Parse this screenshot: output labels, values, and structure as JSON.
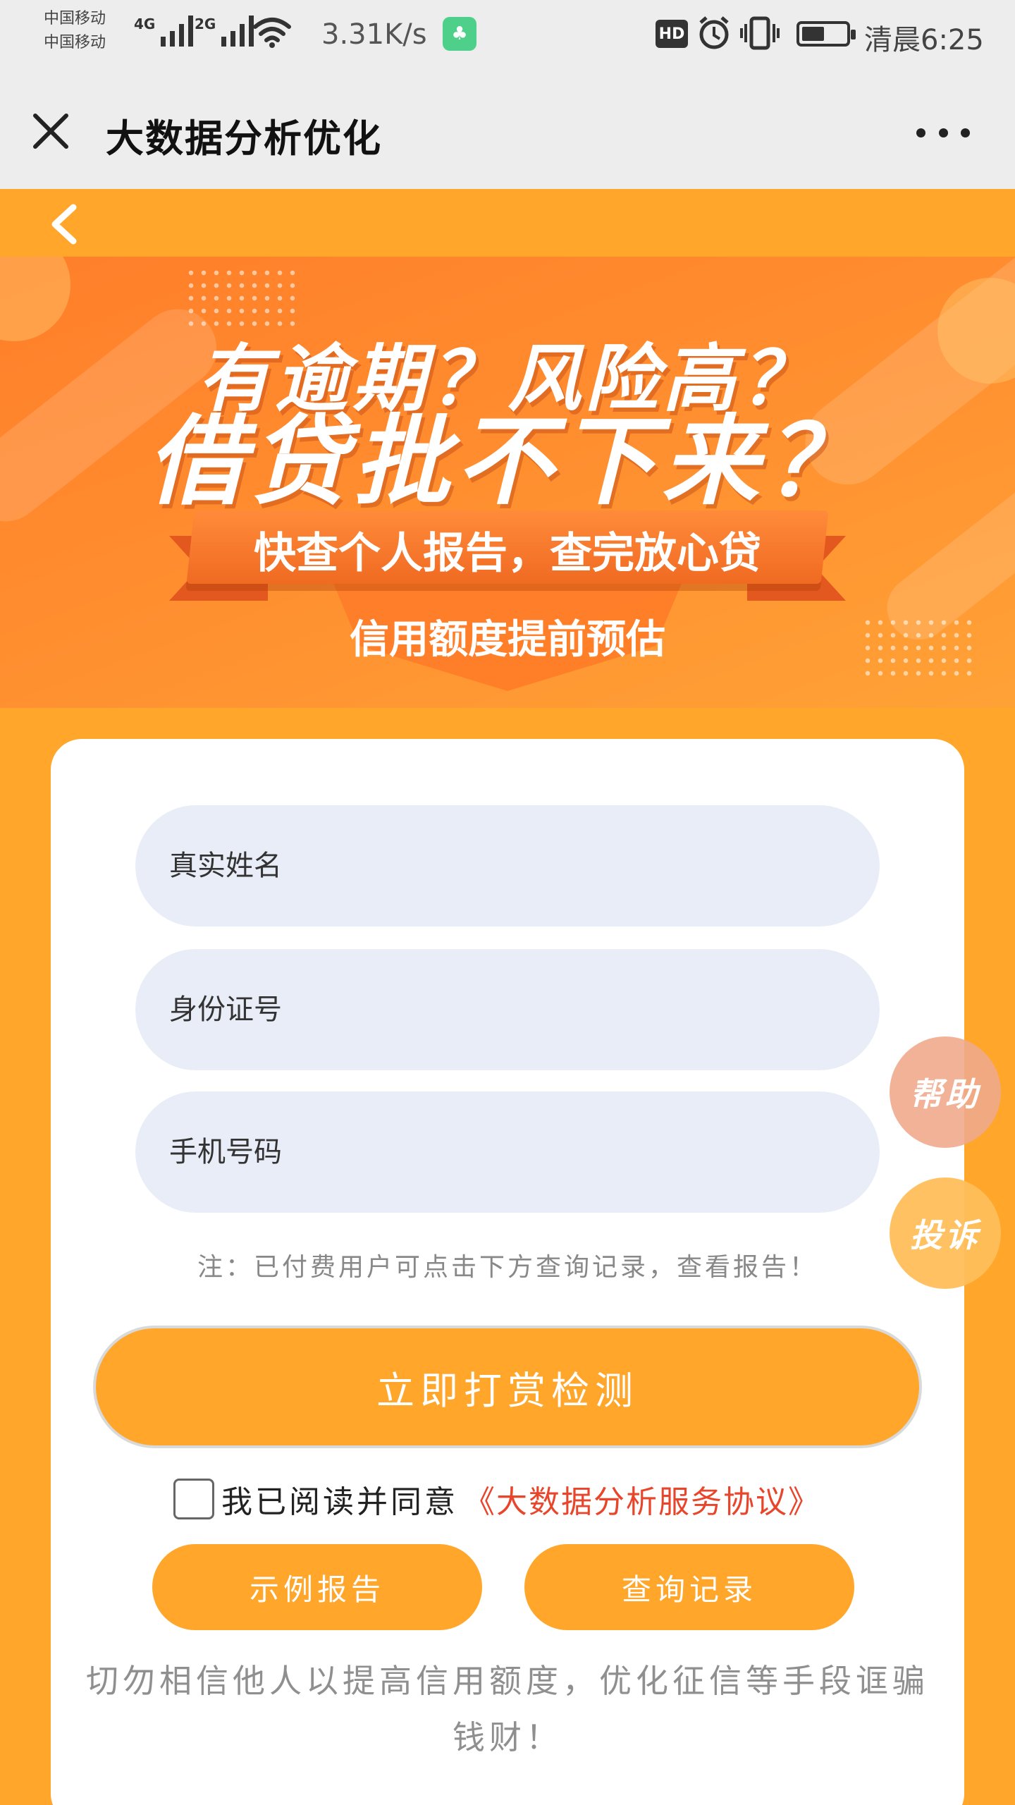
{
  "status_bar": {
    "carrier_1": "中国移动",
    "carrier_2": "中国移动",
    "net_1": "4G",
    "net_2": "2G",
    "speed": "3.31K/s",
    "hd_label": "HD",
    "clock": "清晨6:25",
    "battery_level": 0.45,
    "icons": [
      "signal-icon",
      "wifi-icon",
      "app-icon",
      "hd-icon",
      "alarm-icon",
      "vibrate-icon",
      "battery-icon"
    ]
  },
  "title_bar": {
    "title": "大数据分析优化",
    "close_icon": "close-icon",
    "more_icon": "more-icon"
  },
  "nav": {
    "back_icon": "chevron-left-icon"
  },
  "banner": {
    "line1": "有逾期？风险高？",
    "line2": "借贷批不下来？",
    "ribbon": "快查个人报告，查完放心贷",
    "subtitle": "信用额度提前预估"
  },
  "form": {
    "name_placeholder": "真实姓名",
    "id_placeholder": "身份证号",
    "phone_placeholder": "手机号码",
    "note": "注：已付费用户可点击下方查询记录，查看报告！",
    "submit_label": "立即打赏检测",
    "agree_text": "我已阅读并同意",
    "agree_link": "《大数据分析服务协议》",
    "sample_report_label": "示例报告",
    "query_records_label": "查询记录",
    "warning": "切勿相信他人以提高信用额度，优化征信等手段诓骗钱财！"
  },
  "floating": {
    "help_label": "帮助",
    "complain_label": "投诉"
  },
  "colors": {
    "accent": "#FFA62B",
    "link_red": "#E8452B",
    "field_bg": "#E9EDF8"
  }
}
